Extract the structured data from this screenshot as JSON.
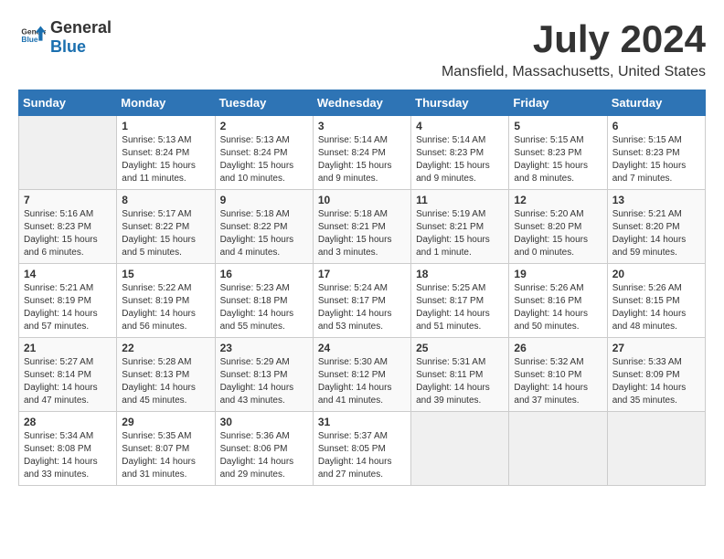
{
  "logo": {
    "general": "General",
    "blue": "Blue"
  },
  "title": "July 2024",
  "subtitle": "Mansfield, Massachusetts, United States",
  "calendar": {
    "headers": [
      "Sunday",
      "Monday",
      "Tuesday",
      "Wednesday",
      "Thursday",
      "Friday",
      "Saturday"
    ],
    "weeks": [
      [
        {
          "day": "",
          "info": ""
        },
        {
          "day": "1",
          "info": "Sunrise: 5:13 AM\nSunset: 8:24 PM\nDaylight: 15 hours\nand 11 minutes."
        },
        {
          "day": "2",
          "info": "Sunrise: 5:13 AM\nSunset: 8:24 PM\nDaylight: 15 hours\nand 10 minutes."
        },
        {
          "day": "3",
          "info": "Sunrise: 5:14 AM\nSunset: 8:24 PM\nDaylight: 15 hours\nand 9 minutes."
        },
        {
          "day": "4",
          "info": "Sunrise: 5:14 AM\nSunset: 8:23 PM\nDaylight: 15 hours\nand 9 minutes."
        },
        {
          "day": "5",
          "info": "Sunrise: 5:15 AM\nSunset: 8:23 PM\nDaylight: 15 hours\nand 8 minutes."
        },
        {
          "day": "6",
          "info": "Sunrise: 5:15 AM\nSunset: 8:23 PM\nDaylight: 15 hours\nand 7 minutes."
        }
      ],
      [
        {
          "day": "7",
          "info": "Sunrise: 5:16 AM\nSunset: 8:23 PM\nDaylight: 15 hours\nand 6 minutes."
        },
        {
          "day": "8",
          "info": "Sunrise: 5:17 AM\nSunset: 8:22 PM\nDaylight: 15 hours\nand 5 minutes."
        },
        {
          "day": "9",
          "info": "Sunrise: 5:18 AM\nSunset: 8:22 PM\nDaylight: 15 hours\nand 4 minutes."
        },
        {
          "day": "10",
          "info": "Sunrise: 5:18 AM\nSunset: 8:21 PM\nDaylight: 15 hours\nand 3 minutes."
        },
        {
          "day": "11",
          "info": "Sunrise: 5:19 AM\nSunset: 8:21 PM\nDaylight: 15 hours\nand 1 minute."
        },
        {
          "day": "12",
          "info": "Sunrise: 5:20 AM\nSunset: 8:20 PM\nDaylight: 15 hours\nand 0 minutes."
        },
        {
          "day": "13",
          "info": "Sunrise: 5:21 AM\nSunset: 8:20 PM\nDaylight: 14 hours\nand 59 minutes."
        }
      ],
      [
        {
          "day": "14",
          "info": "Sunrise: 5:21 AM\nSunset: 8:19 PM\nDaylight: 14 hours\nand 57 minutes."
        },
        {
          "day": "15",
          "info": "Sunrise: 5:22 AM\nSunset: 8:19 PM\nDaylight: 14 hours\nand 56 minutes."
        },
        {
          "day": "16",
          "info": "Sunrise: 5:23 AM\nSunset: 8:18 PM\nDaylight: 14 hours\nand 55 minutes."
        },
        {
          "day": "17",
          "info": "Sunrise: 5:24 AM\nSunset: 8:17 PM\nDaylight: 14 hours\nand 53 minutes."
        },
        {
          "day": "18",
          "info": "Sunrise: 5:25 AM\nSunset: 8:17 PM\nDaylight: 14 hours\nand 51 minutes."
        },
        {
          "day": "19",
          "info": "Sunrise: 5:26 AM\nSunset: 8:16 PM\nDaylight: 14 hours\nand 50 minutes."
        },
        {
          "day": "20",
          "info": "Sunrise: 5:26 AM\nSunset: 8:15 PM\nDaylight: 14 hours\nand 48 minutes."
        }
      ],
      [
        {
          "day": "21",
          "info": "Sunrise: 5:27 AM\nSunset: 8:14 PM\nDaylight: 14 hours\nand 47 minutes."
        },
        {
          "day": "22",
          "info": "Sunrise: 5:28 AM\nSunset: 8:13 PM\nDaylight: 14 hours\nand 45 minutes."
        },
        {
          "day": "23",
          "info": "Sunrise: 5:29 AM\nSunset: 8:13 PM\nDaylight: 14 hours\nand 43 minutes."
        },
        {
          "day": "24",
          "info": "Sunrise: 5:30 AM\nSunset: 8:12 PM\nDaylight: 14 hours\nand 41 minutes."
        },
        {
          "day": "25",
          "info": "Sunrise: 5:31 AM\nSunset: 8:11 PM\nDaylight: 14 hours\nand 39 minutes."
        },
        {
          "day": "26",
          "info": "Sunrise: 5:32 AM\nSunset: 8:10 PM\nDaylight: 14 hours\nand 37 minutes."
        },
        {
          "day": "27",
          "info": "Sunrise: 5:33 AM\nSunset: 8:09 PM\nDaylight: 14 hours\nand 35 minutes."
        }
      ],
      [
        {
          "day": "28",
          "info": "Sunrise: 5:34 AM\nSunset: 8:08 PM\nDaylight: 14 hours\nand 33 minutes."
        },
        {
          "day": "29",
          "info": "Sunrise: 5:35 AM\nSunset: 8:07 PM\nDaylight: 14 hours\nand 31 minutes."
        },
        {
          "day": "30",
          "info": "Sunrise: 5:36 AM\nSunset: 8:06 PM\nDaylight: 14 hours\nand 29 minutes."
        },
        {
          "day": "31",
          "info": "Sunrise: 5:37 AM\nSunset: 8:05 PM\nDaylight: 14 hours\nand 27 minutes."
        },
        {
          "day": "",
          "info": ""
        },
        {
          "day": "",
          "info": ""
        },
        {
          "day": "",
          "info": ""
        }
      ]
    ]
  }
}
